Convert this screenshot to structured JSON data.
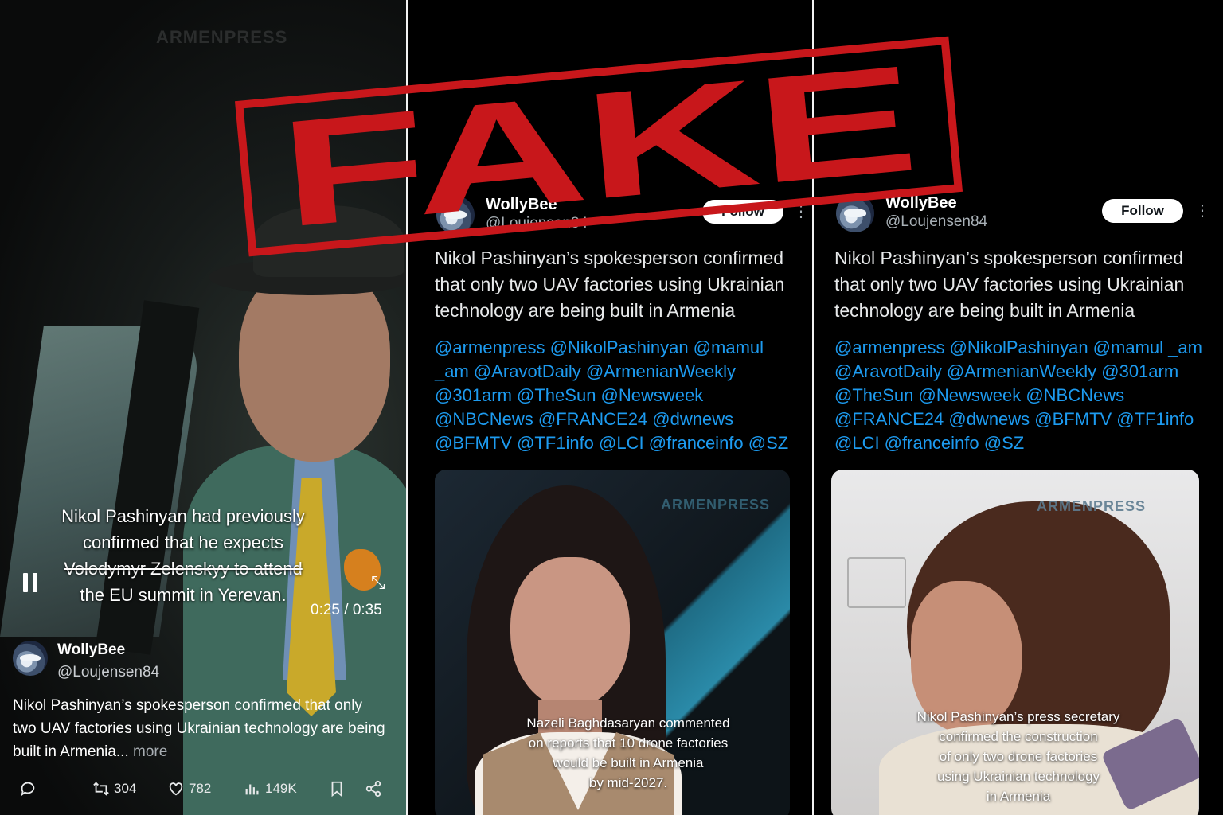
{
  "stamp": {
    "text": "FAKE",
    "color": "#c8171b"
  },
  "panel1": {
    "watermark": "ARMENPRESS",
    "caption_lines": [
      "Nikol Pashinyan had previously",
      "confirmed that he expects",
      "Volodymyr Zelenskyy to attend",
      "the EU summit in Yerevan."
    ],
    "timecode": "0:25 / 0:35",
    "user": {
      "name": "WollyBee",
      "handle": "@Loujensen84"
    },
    "text": "Nikol Pashinyan’s spokesperson confirmed that only two UAV factories using Ukrainian technology are being built in Armenia...",
    "more_label": "more",
    "actions": {
      "retweets": "304",
      "likes": "782",
      "views": "149K"
    },
    "icons": [
      "pause-icon",
      "expand-icon",
      "reply-icon",
      "retweet-icon",
      "like-icon",
      "views-icon",
      "bookmark-icon",
      "share-icon"
    ]
  },
  "panel2": {
    "user": {
      "name": "WollyBee",
      "handle": "@Loujensen84"
    },
    "follow_label": "Follow",
    "text": "Nikol Pashinyan’s spokesperson confirmed that only two UAV factories using Ukrainian technology are being built in Armenia",
    "mentions": "@armenpress @NikolPashinyan @mamul _am @AravotDaily @ArmenianWeekly @301arm @TheSun @Newsweek @NBCNews @FRANCE24 @dwnews @BFMTV @TF1info @LCI @franceinfo @SZ",
    "media": {
      "watermark": "ARMENPRESS",
      "caption_lines": [
        "Nazeli Baghdasaryan commented",
        "on reports that 10 drone factories",
        "would be built in Armenia",
        "by mid-2027."
      ]
    }
  },
  "panel3": {
    "user": {
      "name": "WollyBee",
      "handle": "@Loujensen84"
    },
    "follow_label": "Follow",
    "text": "Nikol Pashinyan’s spokesperson confirmed that only two UAV factories using Ukrainian technology are being built in Armenia",
    "mentions": "@armenpress @NikolPashinyan @mamul _am @AravotDaily @ArmenianWeekly @301arm @TheSun @Newsweek @NBCNews @FRANCE24 @dwnews @BFMTV @TF1info @LCI @franceinfo @SZ",
    "media": {
      "watermark": "ARMENPRESS",
      "caption_lines": [
        "Nikol Pashinyan’s press secretary",
        "confirmed the construction",
        "of only two drone factories",
        "using Ukrainian technology",
        "in Armenia"
      ]
    }
  }
}
